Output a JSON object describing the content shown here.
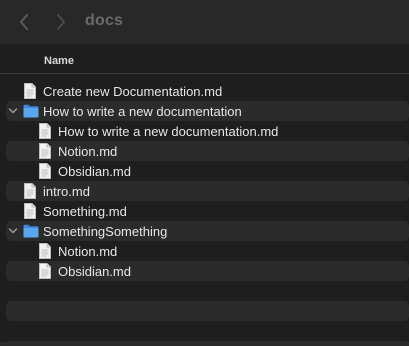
{
  "toolbar": {
    "folder_title": "docs",
    "back_icon": "chevron-left-icon",
    "forward_icon": "chevron-right-icon"
  },
  "columns": {
    "name_label": "Name"
  },
  "rows": [
    {
      "label": "Create new Documentation.md",
      "level": 0,
      "kind": "file",
      "stripe": false
    },
    {
      "label": "How to write a new documentation",
      "level": 0,
      "kind": "folder",
      "expanded": true,
      "stripe": true
    },
    {
      "label": "How to write a new documentation.md",
      "level": 1,
      "kind": "file",
      "stripe": false,
      "highlight": true
    },
    {
      "label": "Notion.md",
      "level": 1,
      "kind": "file",
      "stripe": true
    },
    {
      "label": "Obsidian.md",
      "level": 1,
      "kind": "file",
      "stripe": false
    },
    {
      "label": "intro.md",
      "level": 0,
      "kind": "file",
      "stripe": true
    },
    {
      "label": "Something.md",
      "level": 0,
      "kind": "file",
      "stripe": false
    },
    {
      "label": "SomethingSomething",
      "level": 0,
      "kind": "folder",
      "expanded": true,
      "stripe": true
    },
    {
      "label": "Notion.md",
      "level": 1,
      "kind": "file",
      "stripe": false
    },
    {
      "label": "Obsidian.md",
      "level": 1,
      "kind": "file",
      "stripe": true
    }
  ],
  "colors": {
    "background": "#1e1e1e",
    "toolbar": "#282828",
    "stripe": "#2b2b2b",
    "folder_blue": "#4a9ae8",
    "text": "#e6e6e6",
    "dim_text": "#6a6a6a"
  }
}
